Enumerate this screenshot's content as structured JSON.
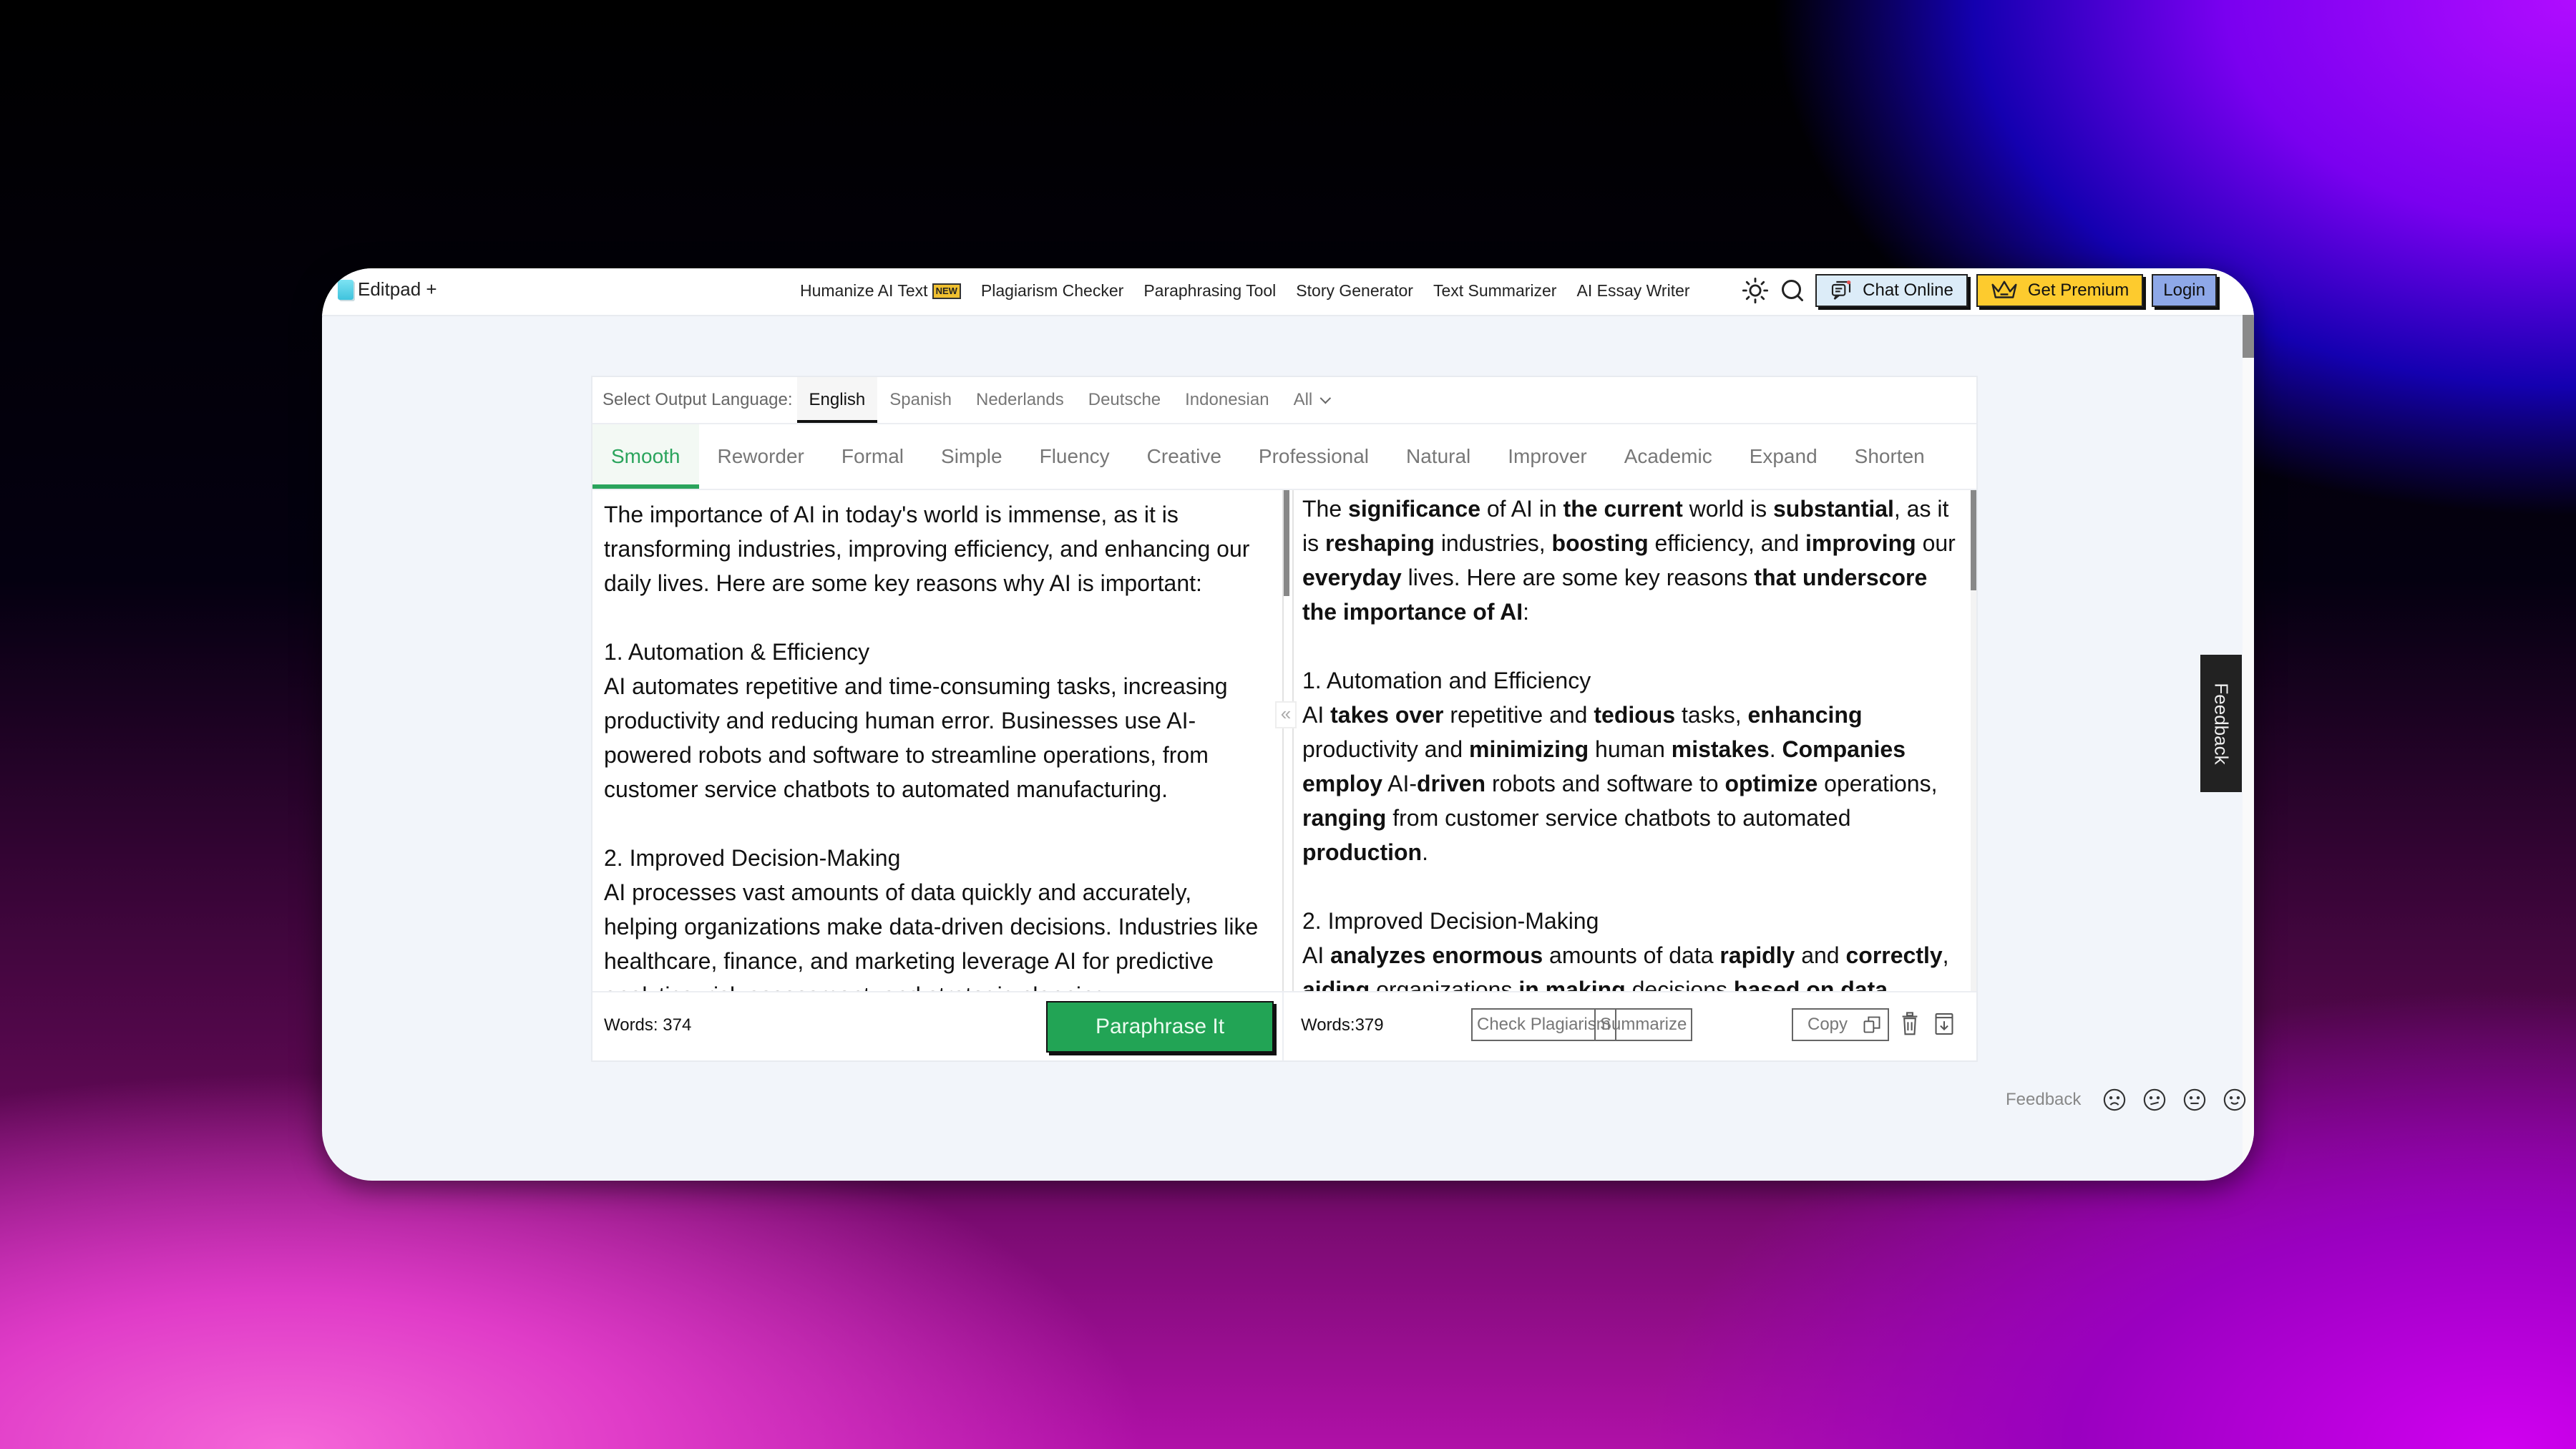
{
  "header": {
    "logo_text": "Editpad +",
    "nav": [
      {
        "label": "Humanize AI Text",
        "badge": "NEW"
      },
      {
        "label": "Plagiarism Checker"
      },
      {
        "label": "Paraphrasing Tool"
      },
      {
        "label": "Story Generator"
      },
      {
        "label": "Text Summarizer"
      },
      {
        "label": "AI Essay Writer"
      }
    ],
    "icons": [
      "sun-icon",
      "search-icon"
    ],
    "chat_label": "Chat Online",
    "premium_label": "Get Premium",
    "login_label": "Login"
  },
  "language": {
    "label": "Select Output Language:",
    "options": [
      "English",
      "Spanish",
      "Nederlands",
      "Deutsche",
      "Indonesian",
      "All"
    ],
    "selected": "English"
  },
  "modes": {
    "options": [
      "Smooth",
      "Reworder",
      "Formal",
      "Simple",
      "Fluency",
      "Creative",
      "Professional",
      "Natural",
      "Improver",
      "Academic",
      "Expand",
      "Shorten"
    ],
    "selected": "Smooth"
  },
  "input": {
    "paragraphs": [
      "The importance of AI in today's world is immense, as it is transforming industries, improving efficiency, and enhancing our daily lives. Here are some key reasons why AI is important:",
      "1. Automation & Efficiency\nAI automates repetitive and time-consuming tasks, increasing productivity and reducing human error. Businesses use AI-powered robots and software to streamline operations, from customer service chatbots to automated manufacturing.",
      "2. Improved Decision-Making\nAI processes vast amounts of data quickly and accurately, helping organizations make data-driven decisions. Industries like healthcare, finance, and marketing leverage AI for predictive analytics, risk assessment, and strategic planning."
    ],
    "word_count": "Words: 374",
    "paraphrase_label": "Paraphrase It"
  },
  "output": {
    "paragraphs": [
      [
        [
          "The ",
          false
        ],
        [
          "significance",
          true
        ],
        [
          " of AI in ",
          false
        ],
        [
          "the current",
          true
        ],
        [
          " world is ",
          false
        ],
        [
          "substantial",
          true
        ],
        [
          ", as it is ",
          false
        ],
        [
          "reshaping",
          true
        ],
        [
          " industries, ",
          false
        ],
        [
          "boosting",
          true
        ],
        [
          " efficiency, and ",
          false
        ],
        [
          "improving",
          true
        ],
        [
          " our ",
          false
        ],
        [
          "everyday",
          true
        ],
        [
          " lives. Here are some key reasons ",
          false
        ],
        [
          "that underscore the importance of AI",
          true
        ],
        [
          ":",
          false
        ]
      ],
      [
        [
          "1. Automation and Efficiency\nAI ",
          false
        ],
        [
          "takes over",
          true
        ],
        [
          " repetitive and ",
          false
        ],
        [
          "tedious",
          true
        ],
        [
          " tasks, ",
          false
        ],
        [
          "enhancing",
          true
        ],
        [
          " productivity and ",
          false
        ],
        [
          "minimizing",
          true
        ],
        [
          " human ",
          false
        ],
        [
          "mistakes",
          true
        ],
        [
          ". ",
          false
        ],
        [
          "Companies employ",
          true
        ],
        [
          " AI-",
          false
        ],
        [
          "driven",
          true
        ],
        [
          " robots and software to ",
          false
        ],
        [
          "optimize",
          true
        ],
        [
          " operations, ",
          false
        ],
        [
          "ranging",
          true
        ],
        [
          " from customer service chatbots to automated ",
          false
        ],
        [
          "production",
          true
        ],
        [
          ".",
          false
        ]
      ],
      [
        [
          "2. Improved Decision-Making\nAI ",
          false
        ],
        [
          "analyzes enormous",
          true
        ],
        [
          " amounts of data ",
          false
        ],
        [
          "rapidly",
          true
        ],
        [
          " and ",
          false
        ],
        [
          "correctly",
          true
        ],
        [
          ", ",
          false
        ],
        [
          "aiding",
          true
        ],
        [
          " organizations ",
          false
        ],
        [
          "in making",
          true
        ],
        [
          " decisions ",
          false
        ],
        [
          "based on data",
          true
        ],
        [
          ".",
          false
        ]
      ]
    ],
    "word_count": "Words:379",
    "check_plagiarism_label": "Check Plagiarism",
    "summarize_label": "Summarize",
    "copy_label": "Copy"
  },
  "feedback": {
    "label": "Feedback",
    "faces": [
      "very-sad-face-icon",
      "confused-face-icon",
      "neutral-face-icon",
      "smile-face-icon",
      "grin-face-icon"
    ],
    "side_tab_label": "Feedback"
  },
  "colors": {
    "accent_green": "#22a455",
    "premium_yellow": "#fdcb2e",
    "login_blue": "#8ea8e8",
    "chat_blue": "#dcecf8"
  }
}
